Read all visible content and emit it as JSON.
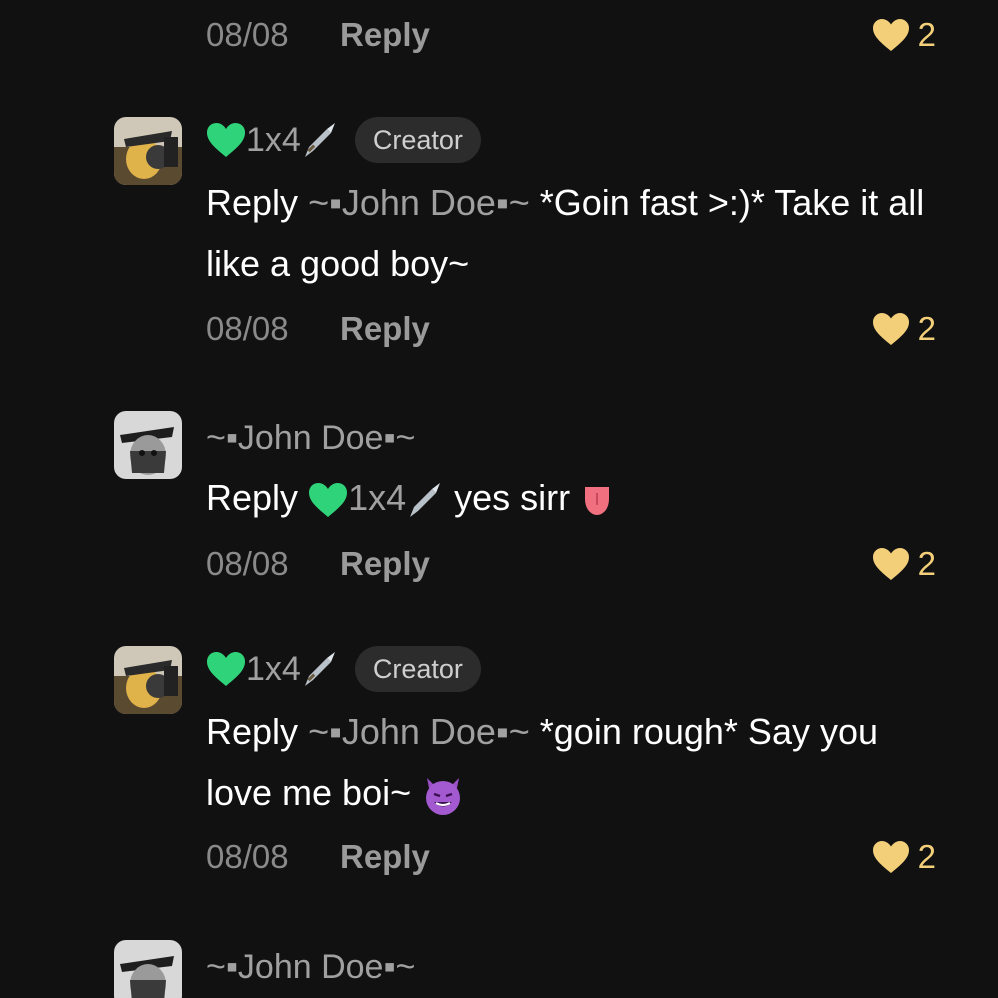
{
  "top_meta": {
    "date": "08/08",
    "reply_label": "Reply",
    "likes": "2"
  },
  "comments": [
    {
      "username": "1x4",
      "badge": "Creator",
      "reply_prefix": "Reply",
      "mention": "~▪John Doe▪~",
      "text": "*Goin fast >:)* Take it all like a good boy~",
      "date": "08/08",
      "reply_label": "Reply",
      "likes": "2"
    },
    {
      "username": "~▪John Doe▪~",
      "reply_prefix": "Reply",
      "mention": "1x4",
      "text": "yes sirr",
      "date": "08/08",
      "reply_label": "Reply",
      "likes": "2"
    },
    {
      "username": "1x4",
      "badge": "Creator",
      "reply_prefix": "Reply",
      "mention": "~▪John Doe▪~",
      "text": "*goin rough* Say you love me boi~",
      "date": "08/08",
      "reply_label": "Reply",
      "likes": "2"
    },
    {
      "username": "~▪John Doe▪~"
    }
  ],
  "colors": {
    "background": "#111111",
    "heart_like": "#f3cf7a",
    "green_heart": "#2fd47a",
    "muted_text": "#a0a0a0"
  },
  "icons": [
    "green-heart-icon",
    "dagger-icon",
    "like-heart-icon",
    "tongue-emoji-icon",
    "smiling-devil-emoji-icon"
  ]
}
